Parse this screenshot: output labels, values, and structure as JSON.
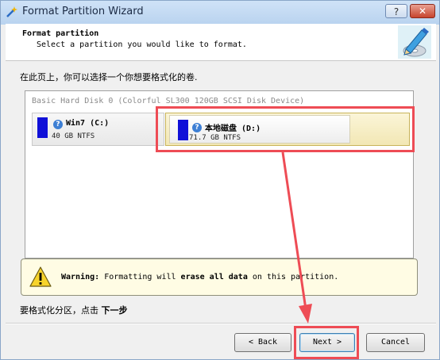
{
  "window": {
    "title": "Format Partition Wizard",
    "help_label": "?",
    "close_label": "✕"
  },
  "header": {
    "title": "Format partition",
    "subtitle": "Select a partition you would like to format."
  },
  "instruction": "在此页上，你可以选择一个你想要格式化的卷.",
  "disk": {
    "title": "Basic Hard Disk 0 (Colorful SL300 120GB SCSI Disk Device)",
    "partitions": [
      {
        "name": "Win7 (C:)",
        "size": "40 GB NTFS",
        "selected": false
      },
      {
        "name": "本地磁盘 (D:)",
        "size": "71.7 GB NTFS",
        "selected": true
      }
    ]
  },
  "warning": {
    "label": "Warning:",
    "text_1": "Formatting will",
    "emphasis": "erase all data",
    "text_2": "on this partition."
  },
  "hint": {
    "text": "要格式化分区，点击",
    "emphasis": "下一步"
  },
  "buttons": {
    "back": "< Back",
    "next": "Next >",
    "cancel": "Cancel"
  },
  "colors": {
    "annotation": "#ee4c55",
    "partition_bar": "#1010d8",
    "selected_partition": "#f2e7b4"
  }
}
